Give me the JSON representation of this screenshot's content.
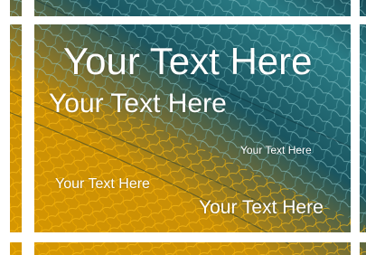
{
  "colors": {
    "frame": "#ffffff",
    "teal": "#1f6b75",
    "dark_teal": "#0e3a44",
    "amber": "#e1a000",
    "text": "#ffffff"
  },
  "texts": {
    "headline": "Your Text Here",
    "subheadline": "Your Text Here",
    "small_right": "Your Text Here",
    "small_left": "Your Text Here",
    "bottom_right": "Your Text Here"
  }
}
